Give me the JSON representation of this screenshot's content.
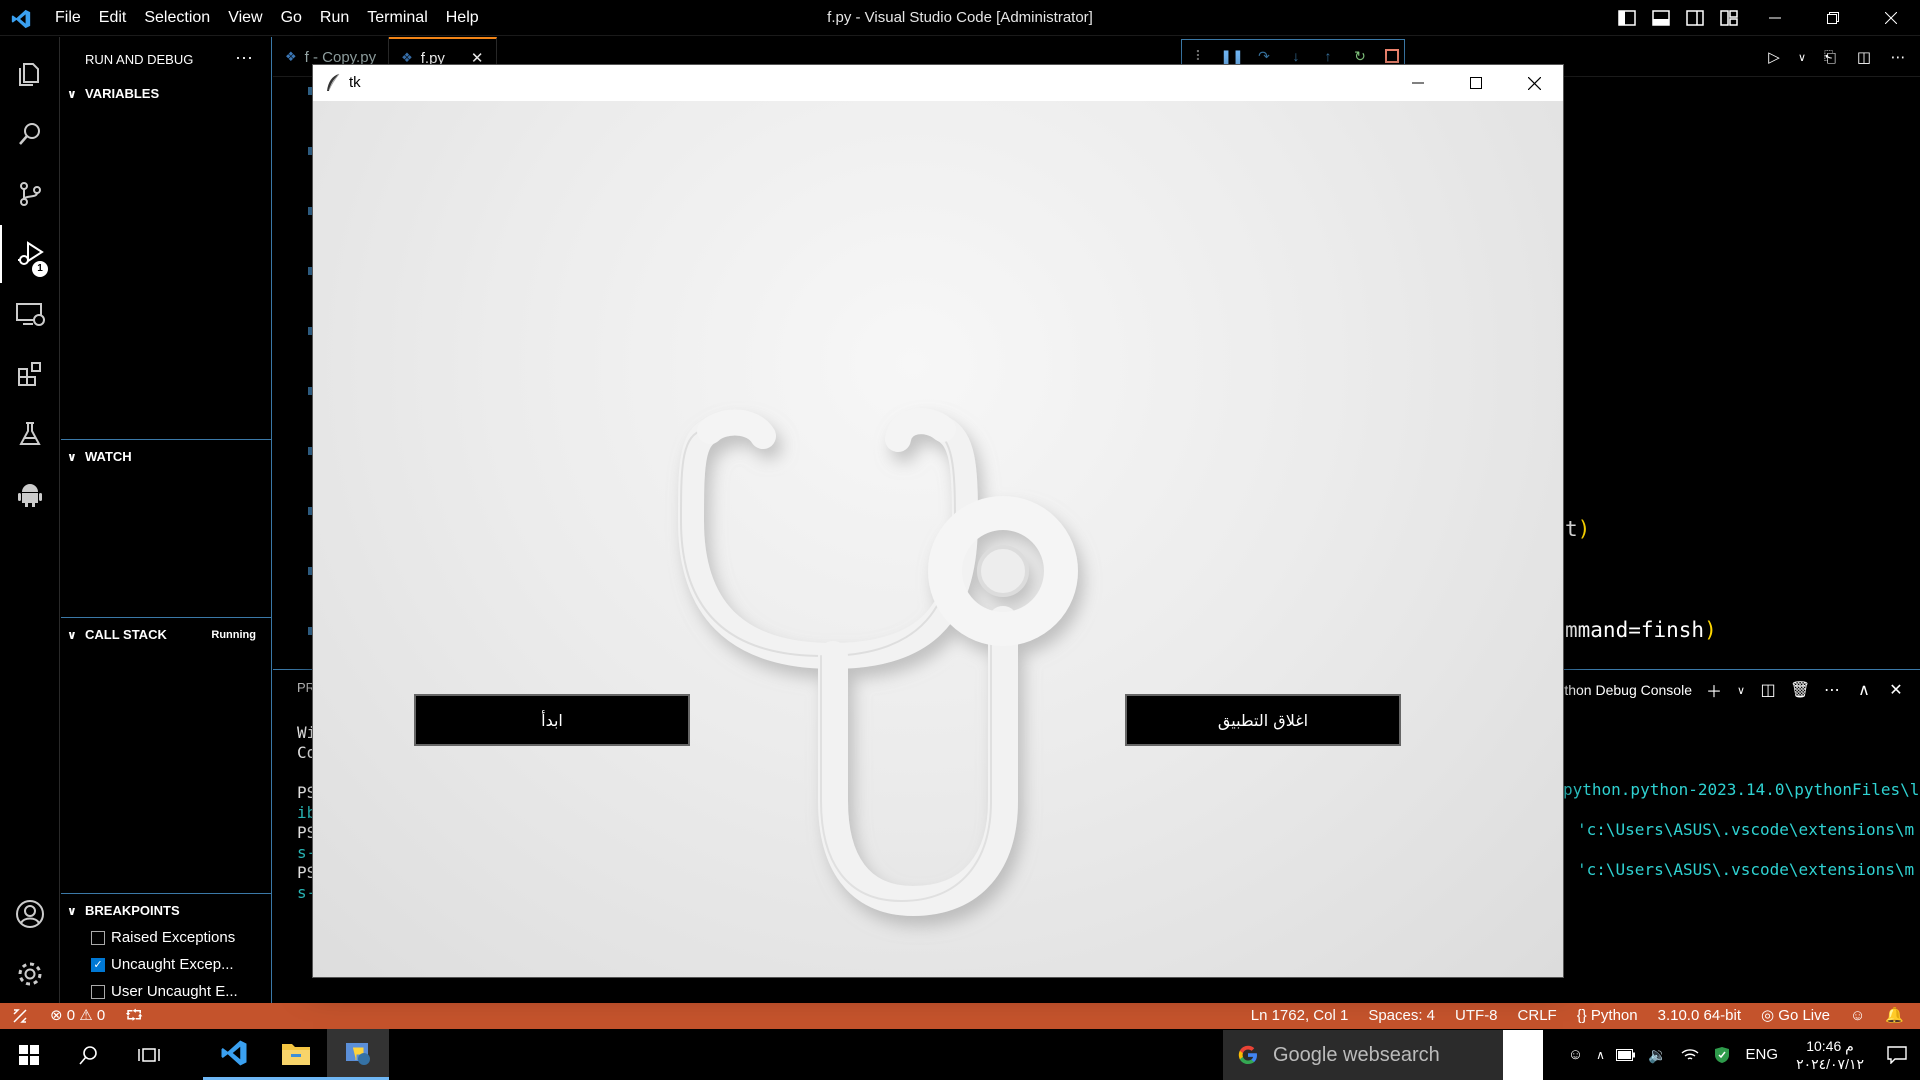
{
  "app": {
    "window_title": "f.py - Visual Studio Code [Administrator]",
    "menu": [
      "File",
      "Edit",
      "Selection",
      "View",
      "Go",
      "Run",
      "Terminal",
      "Help"
    ]
  },
  "activity_bar": {
    "items": [
      "explorer-icon",
      "search-icon",
      "source-control-icon",
      "run-debug-icon",
      "remote-explorer-icon",
      "extensions-icon",
      "testing-icon",
      "android-icon",
      "account-icon",
      "settings-gear-icon"
    ],
    "debug_badge": "1"
  },
  "sidebar": {
    "title": "RUN AND DEBUG",
    "more": "···",
    "sections": {
      "variables": "VARIABLES",
      "watch": "WATCH",
      "call_stack": "CALL STACK",
      "call_stack_status": "Running",
      "breakpoints": "BREAKPOINTS"
    },
    "breakpoints": [
      {
        "label": "Raised Exceptions",
        "checked": false
      },
      {
        "label": "Uncaught Excep...",
        "checked": true
      },
      {
        "label": "User Uncaught E...",
        "checked": false
      }
    ]
  },
  "editor": {
    "tabs": [
      {
        "label": "f - Copy.py",
        "active": false
      },
      {
        "label": "f.py",
        "active": true
      }
    ],
    "code_fragments": {
      "line1_plain": "t",
      "line1_paren": ")",
      "line2_plain": "mmand=finsh",
      "line2_paren": ")"
    }
  },
  "panel": {
    "left_tab": "PR",
    "terminal_name": "Python Debug Console",
    "left_lines": [
      "Wi",
      "Co",
      "PS",
      "ib",
      "PS",
      "s-",
      "PS",
      "s-"
    ],
    "right_lines": [
      "python.python-2023.14.0\\pythonFiles\\l",
      "'c:\\Users\\ASUS\\.vscode\\extensions\\m",
      "'c:\\Users\\ASUS\\.vscode\\extensions\\m"
    ]
  },
  "statusbar": {
    "errors": "0",
    "warnings": "0",
    "position": "Ln 1762, Col 1",
    "spaces": "Spaces: 4",
    "encoding": "UTF-8",
    "eol": "CRLF",
    "language": "Python",
    "interpreter": "3.10.0 64-bit",
    "go_live": "Go Live"
  },
  "taskbar": {
    "search_placeholder": "Google websearch",
    "language": "ENG",
    "time": "10:46 م",
    "date": "٢٠٢٤/٠٧/١٢"
  },
  "tk_window": {
    "title": "tk",
    "start_button": "ابدأ",
    "close_app_button": "اغلاق التطبيق"
  },
  "colors": {
    "statusbar_bg": "#c4532c",
    "accent_border": "#3b79a8",
    "active_tab_border": "#f38518",
    "terminal_cyan": "#2fd2d2",
    "code_yellow": "#ffd700"
  }
}
